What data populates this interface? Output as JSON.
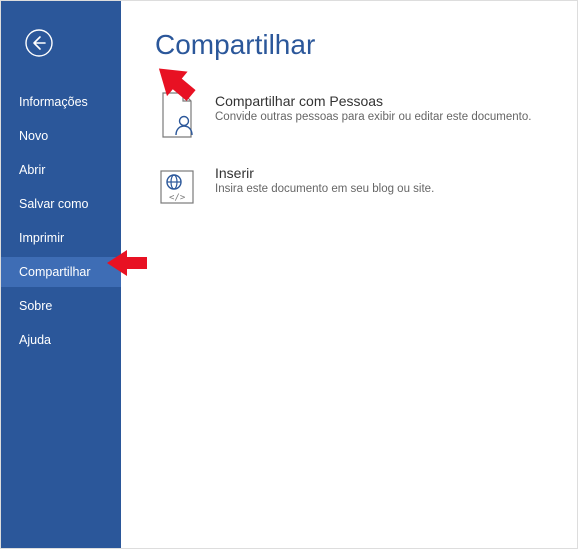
{
  "sidebar": {
    "items": [
      {
        "label": "Informações"
      },
      {
        "label": "Novo"
      },
      {
        "label": "Abrir"
      },
      {
        "label": "Salvar como"
      },
      {
        "label": "Imprimir"
      },
      {
        "label": "Compartilhar"
      },
      {
        "label": "Sobre"
      },
      {
        "label": "Ajuda"
      }
    ],
    "selected_index": 5
  },
  "main": {
    "title": "Compartilhar",
    "options": [
      {
        "title": "Compartilhar com Pessoas",
        "desc": "Convide outras pessoas para exibir ou editar este documento."
      },
      {
        "title": "Inserir",
        "desc": "Insira este documento em seu blog ou site."
      }
    ]
  }
}
